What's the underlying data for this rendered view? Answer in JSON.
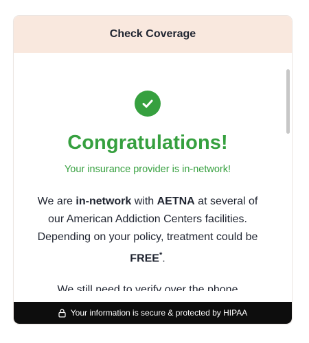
{
  "header": {
    "title": "Check Coverage"
  },
  "result": {
    "icon": "check-circle-icon",
    "headline": "Congratulations!",
    "subline": "Your insurance provider is in-network!"
  },
  "message": {
    "part1": "We are ",
    "bold1": "in-network",
    "part2": " with ",
    "bold2": "AETNA",
    "part3": " at several of our American Addiction Centers facilities. Depending on your policy, treatment could be ",
    "bold3": "FREE",
    "asterisk": "*",
    "part4": ".",
    "next_line": "We still need to verify over the phone"
  },
  "footer": {
    "icon": "lock-icon",
    "text": "Your information is secure & protected by HIPAA"
  },
  "colors": {
    "accent_green": "#36a03f",
    "header_bg": "#f9e8de",
    "footer_bg": "#0d0d0d",
    "text_dark": "#1f2430"
  }
}
